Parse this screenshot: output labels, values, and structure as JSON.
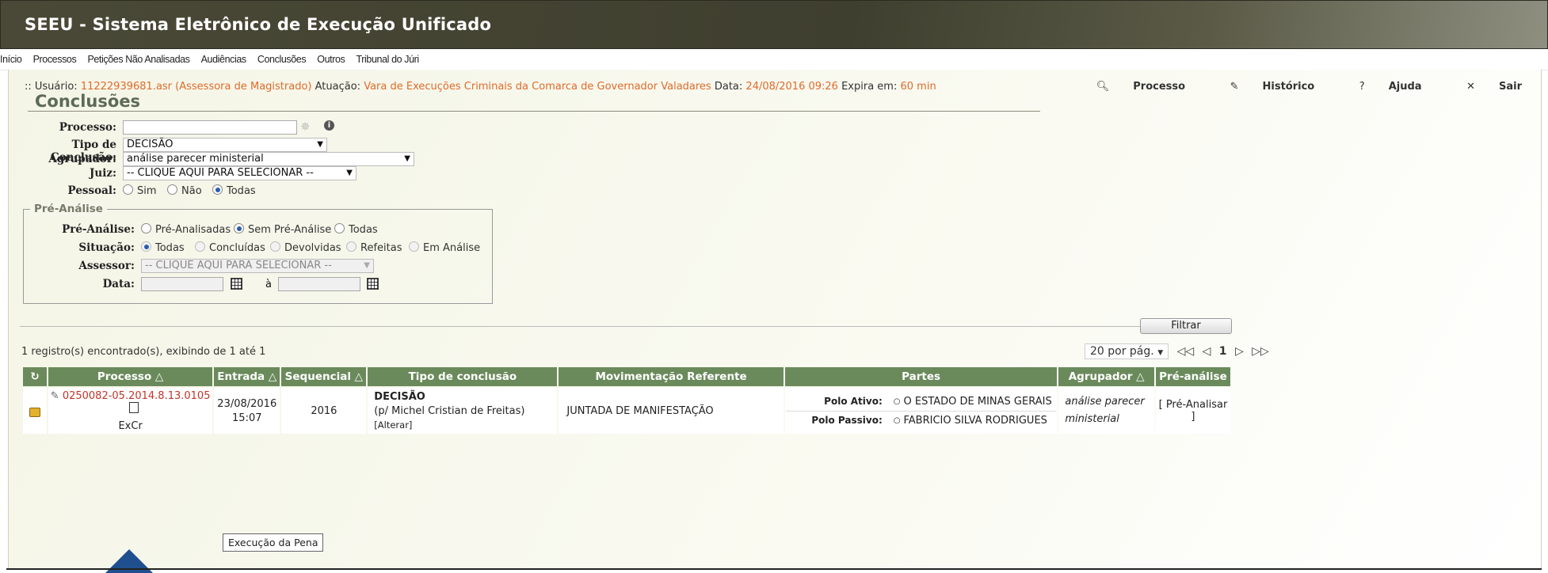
{
  "window": {
    "title": "SEEU - Sistema Eletrônico de Execução Unificado"
  },
  "menu": {
    "items": [
      "Início",
      "Processos",
      "Petições Não Analisadas",
      "Audiências",
      "Conclusões",
      "Outros",
      "Tribunal do Júri"
    ]
  },
  "session": {
    "user_label": ":: Usuário:",
    "user_value": "11222939681.asr (Assessora de Magistrado)",
    "acting_label": "Atuação:",
    "acting_value": "Vara de Execuções Criminais da Comarca de Governador Valadares",
    "date_label": "Data:",
    "date_value": "24/08/2016 09:26",
    "expires_label": "Expira em:",
    "expires_value": "60 min"
  },
  "toplinks": {
    "processo": "Processo",
    "historico": "Histórico",
    "ajuda": "Ajuda",
    "sair": "Sair"
  },
  "page": {
    "title": "Conclusões"
  },
  "form": {
    "processo_label": "Processo:",
    "processo_value": "",
    "tipo_label": "Tipo de Conclusão:",
    "tipo_value": "DECISÃO",
    "agrupador_label": "Agrupador:",
    "agrupador_value": "análise parecer ministerial",
    "juiz_label": "Juiz:",
    "juiz_value": "-- CLIQUE AQUI PARA SELECIONAR --",
    "pessoal_label": "Pessoal:",
    "pessoal_options": [
      "Sim",
      "Não",
      "Todas"
    ],
    "pessoal_selected": "Todas"
  },
  "pre_analise": {
    "legend": "Pré-Análise",
    "pre_label": "Pré-Análise:",
    "pre_options": [
      "Pré-Analisadas",
      "Sem Pré-Análise",
      "Todas"
    ],
    "pre_selected": "Sem Pré-Análise",
    "situacao_label": "Situação:",
    "situacao_options": [
      "Todas",
      "Concluídas",
      "Devolvidas",
      "Refeitas",
      "Em Análise"
    ],
    "situacao_selected": "Todas",
    "assessor_label": "Assessor:",
    "assessor_value": "-- CLIQUE AQUI PARA SELECIONAR --",
    "data_label": "Data:",
    "data_sep": "à"
  },
  "filter_button": "Filtrar",
  "results": {
    "count_text": "1 registro(s) encontrado(s), exibindo de 1 até 1",
    "per_page": "20 por pág.",
    "page": "1"
  },
  "table": {
    "headers": [
      "Processo △",
      "Entrada △",
      "Sequencial △",
      "Tipo de conclusão",
      "Movimentação Referente",
      "Partes",
      "Agrupador △",
      "Pré-análise"
    ],
    "row": {
      "processo": "0250082-05.2014.8.13.0105",
      "classe": "ExCr",
      "entrada_date": "23/08/2016",
      "entrada_time": "15:07",
      "sequencial": "2016",
      "tipo_title": "DECISÃO",
      "tipo_sub": "(p/ Michel Cristian de Freitas)",
      "tipo_link": "[Alterar]",
      "movimentacao": "JUNTADA DE MANIFESTAÇÃO",
      "polo_ativo_label": "Polo Ativo:",
      "polo_ativo_value": "O ESTADO DE MINAS GERAIS",
      "polo_passivo_label": "Polo Passivo:",
      "polo_passivo_value": "FABRICIO SILVA RODRIGUES",
      "agrupador": "análise parecer ministerial",
      "pre_analise_link": "[ Pré-Analisar ]"
    }
  },
  "tooltip": "Execução da Pena",
  "colors": {
    "accent_orange": "#e06b2a",
    "header_green": "#6b8a5c",
    "link_red": "#c2352a"
  }
}
